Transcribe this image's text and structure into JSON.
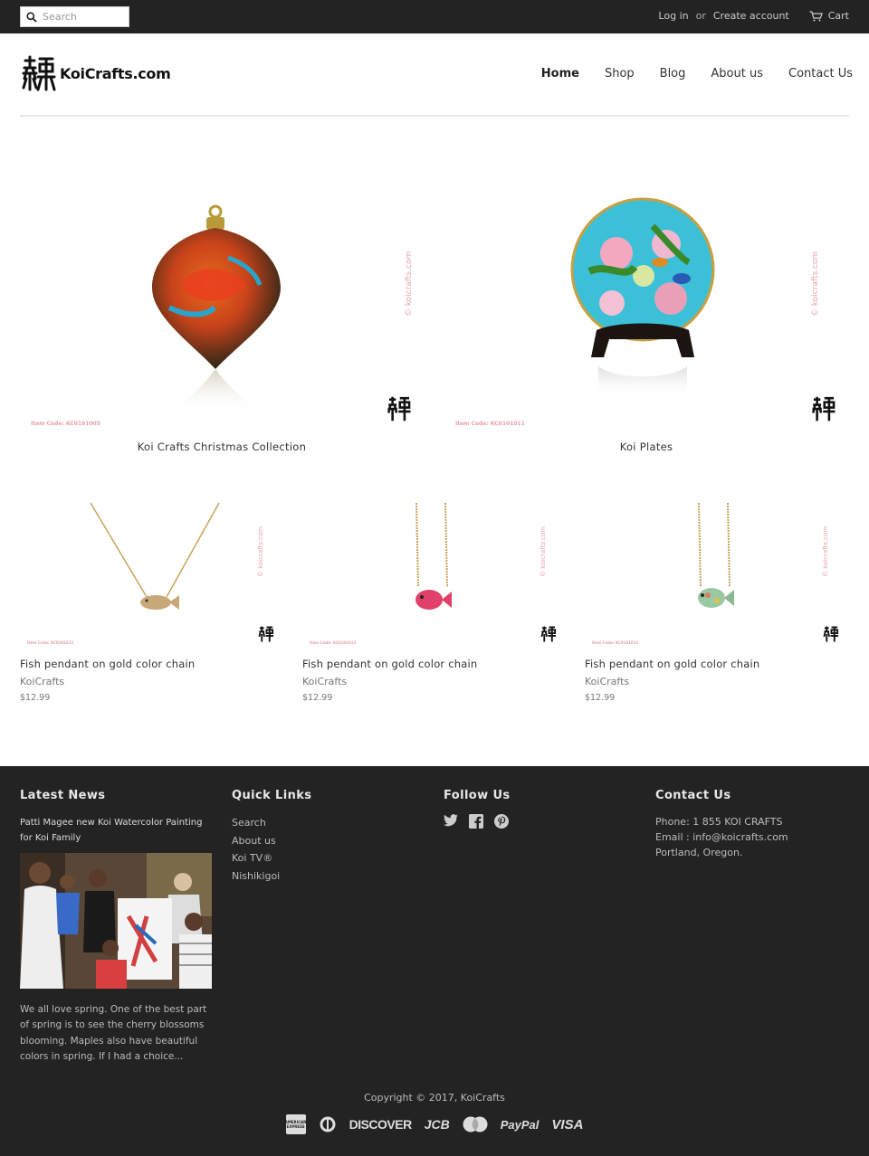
{
  "topbar": {
    "search_placeholder": "Search",
    "login": "Log in",
    "or": "or",
    "create_account": "Create account",
    "cart": "Cart"
  },
  "header": {
    "logo_text": "KoiCrafts.com",
    "nav": [
      "Home",
      "Shop",
      "Blog",
      "About us",
      "Contact Us"
    ]
  },
  "collections": [
    {
      "label": "Koi Crafts Christmas Collection",
      "item_code": "Item Code: KC0101005",
      "watermark": "© koicrafts.com"
    },
    {
      "label": "Koi Plates",
      "item_code": "Item Code: KC0101011",
      "watermark": "© koicrafts.com"
    }
  ],
  "products": [
    {
      "title": "Fish pendant on gold color chain",
      "vendor": "KoiCrafts",
      "price": "$12.99"
    },
    {
      "title": "Fish pendant on gold color chain",
      "vendor": "KoiCrafts",
      "price": "$12.99"
    },
    {
      "title": "Fish pendant on gold color chain",
      "vendor": "KoiCrafts",
      "price": "$12.99"
    }
  ],
  "product_watermark": "© koicrafts.com",
  "product_item_code": "Item Code: KC0101011",
  "footer": {
    "latest_news": {
      "heading": "Latest News",
      "title": "Patti Magee new Koi Watercolor Painting for Koi Family",
      "body": "We all love spring. One of the best part of spring is to see the cherry blossoms blooming. Maples also have beautiful colors in spring. If I had a choice..."
    },
    "quick_links": {
      "heading": "Quick Links",
      "items": [
        "Search",
        "About us",
        "Koi TV®",
        "Nishikigoi"
      ]
    },
    "follow_us": {
      "heading": "Follow Us",
      "icons": [
        "twitter-icon",
        "facebook-icon",
        "pinterest-icon"
      ]
    },
    "contact_us": {
      "heading": "Contact Us",
      "phone": "Phone: 1 855 KOI CRAFTS",
      "email": "Email : info@koicrafts.com",
      "address": "Portland, Oregon."
    },
    "copyright": "Copyright © 2017, KoiCrafts",
    "payments": [
      "AMERICAN EXPRESS",
      "Diners",
      "DISCOVER",
      "JCB",
      "MasterCard",
      "PayPal",
      "VISA"
    ]
  }
}
